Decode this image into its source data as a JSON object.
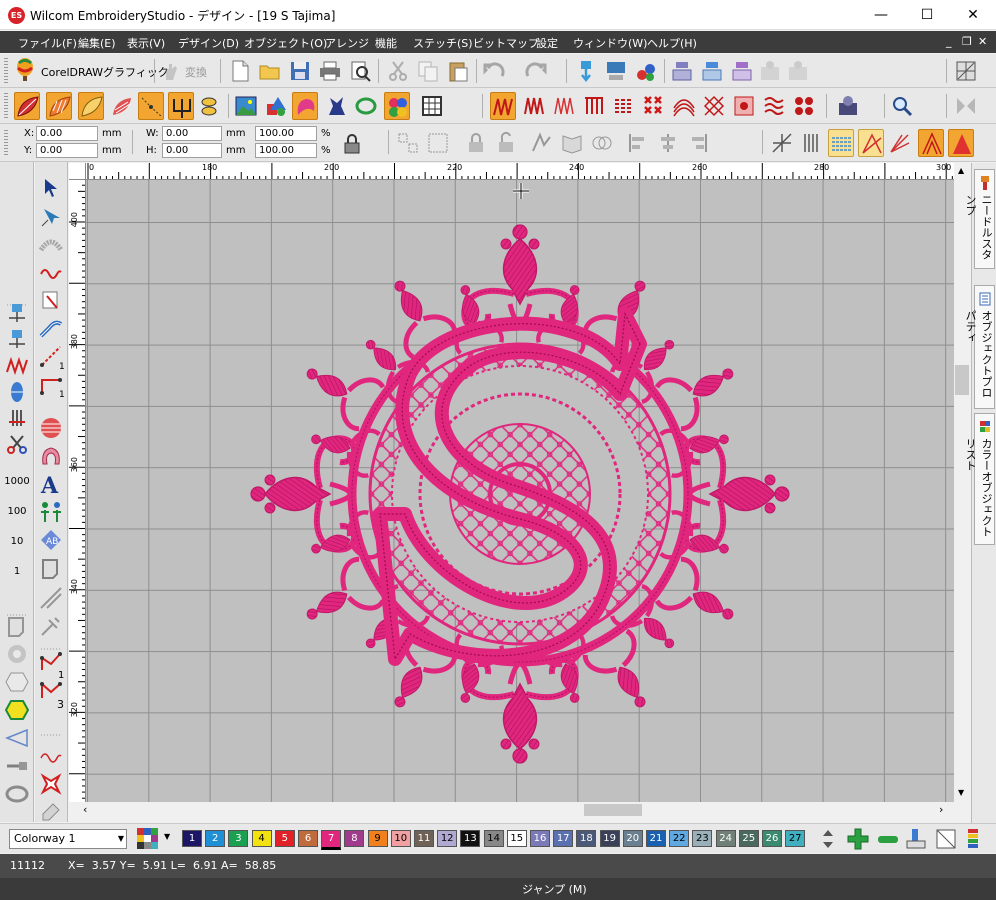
{
  "window": {
    "logo_text": "ES",
    "title": "Wilcom EmbroideryStudio - デザイン - [19  S         Tajima]",
    "minimize": "—",
    "maximize": "☐",
    "close": "✕"
  },
  "menubar": {
    "items": [
      "ファイル(F)",
      "編集(E)",
      "表示(V)",
      "デザイン(D)",
      "オブジェクト(O)",
      "アレンジ",
      "機能",
      "ステッチ(S)",
      "ビットマップ",
      "設定",
      "ウィンドウ(W)",
      "ヘルプ(H)"
    ],
    "mdi_minimize": "_",
    "mdi_restore": "❐",
    "mdi_close": "✕"
  },
  "toolbar_standard": {
    "coreldraw_label": "CorelDRAWグラフィック",
    "convert_label": "変換"
  },
  "coords": {
    "x_label": "X:",
    "x_value": "0.00",
    "x_unit": "mm",
    "y_label": "Y:",
    "y_value": "0.00",
    "y_unit": "mm",
    "w_label": "W:",
    "w_value": "0.00",
    "w_unit": "mm",
    "h_label": "H:",
    "h_value": "0.00",
    "h_unit": "mm",
    "sx_value": "100.00",
    "sx_unit": "%",
    "sy_value": "100.00",
    "sy_unit": "%"
  },
  "ruler": {
    "top_labels": [
      "0",
      "180",
      "200",
      "220",
      "240",
      "260",
      "280",
      "300"
    ],
    "left_labels": [
      "400",
      "380",
      "360",
      "340",
      "320"
    ]
  },
  "left_toolbar": {
    "labels": [
      "1000",
      "100",
      "10",
      "1"
    ],
    "node_labels": [
      "1",
      "1",
      "1",
      "3"
    ]
  },
  "docker": {
    "tabs": [
      "ニードルスタンプ",
      "オブジェクトプロパティ",
      "カラーオブジェクトリスト"
    ]
  },
  "palette": {
    "colorway": "Colorway 1",
    "swatches": [
      {
        "n": "1",
        "bg": "#1c1666",
        "fg": "#ffffff"
      },
      {
        "n": "2",
        "bg": "#1f8fd6",
        "fg": "#ffffff"
      },
      {
        "n": "3",
        "bg": "#1aa050",
        "fg": "#ffffff"
      },
      {
        "n": "4",
        "bg": "#f2e20f",
        "fg": "#000000"
      },
      {
        "n": "5",
        "bg": "#e12028",
        "fg": "#ffffff"
      },
      {
        "n": "6",
        "bg": "#c06b3c",
        "fg": "#ffffff"
      },
      {
        "n": "7",
        "bg": "#e1267e",
        "fg": "#ffffff"
      },
      {
        "n": "8",
        "bg": "#a03a8c",
        "fg": "#ffffff"
      },
      {
        "n": "9",
        "bg": "#f0801e",
        "fg": "#000000"
      },
      {
        "n": "10",
        "bg": "#f0a0a0",
        "fg": "#000000"
      },
      {
        "n": "11",
        "bg": "#6e6258",
        "fg": "#ffffff"
      },
      {
        "n": "12",
        "bg": "#b0a8d0",
        "fg": "#000000"
      },
      {
        "n": "13",
        "bg": "#101010",
        "fg": "#ffffff"
      },
      {
        "n": "14",
        "bg": "#888888",
        "fg": "#000000"
      },
      {
        "n": "15",
        "bg": "#ffffff",
        "fg": "#000000"
      },
      {
        "n": "16",
        "bg": "#7a7ab8",
        "fg": "#ffffff"
      },
      {
        "n": "17",
        "bg": "#5a70b0",
        "fg": "#ffffff"
      },
      {
        "n": "18",
        "bg": "#4a5a78",
        "fg": "#ffffff"
      },
      {
        "n": "19",
        "bg": "#3a4058",
        "fg": "#ffffff"
      },
      {
        "n": "20",
        "bg": "#6a8090",
        "fg": "#ffffff"
      },
      {
        "n": "21",
        "bg": "#1a60b0",
        "fg": "#ffffff"
      },
      {
        "n": "22",
        "bg": "#60a8e0",
        "fg": "#000000"
      },
      {
        "n": "23",
        "bg": "#9ab0b8",
        "fg": "#000000"
      },
      {
        "n": "24",
        "bg": "#708078",
        "fg": "#ffffff"
      },
      {
        "n": "25",
        "bg": "#4a6a60",
        "fg": "#ffffff"
      },
      {
        "n": "26",
        "bg": "#3a8a70",
        "fg": "#ffffff"
      },
      {
        "n": "27",
        "bg": "#40b0c0",
        "fg": "#000000"
      }
    ],
    "selected_index": 6
  },
  "status": {
    "stitch_count": "11112",
    "readout": "X=  3.57 Y=  5.91 L=  6.91 A=  58.85",
    "mode": "ジャンプ (M)"
  },
  "design": {
    "thread_color": "#e1267e",
    "letter": "S"
  }
}
